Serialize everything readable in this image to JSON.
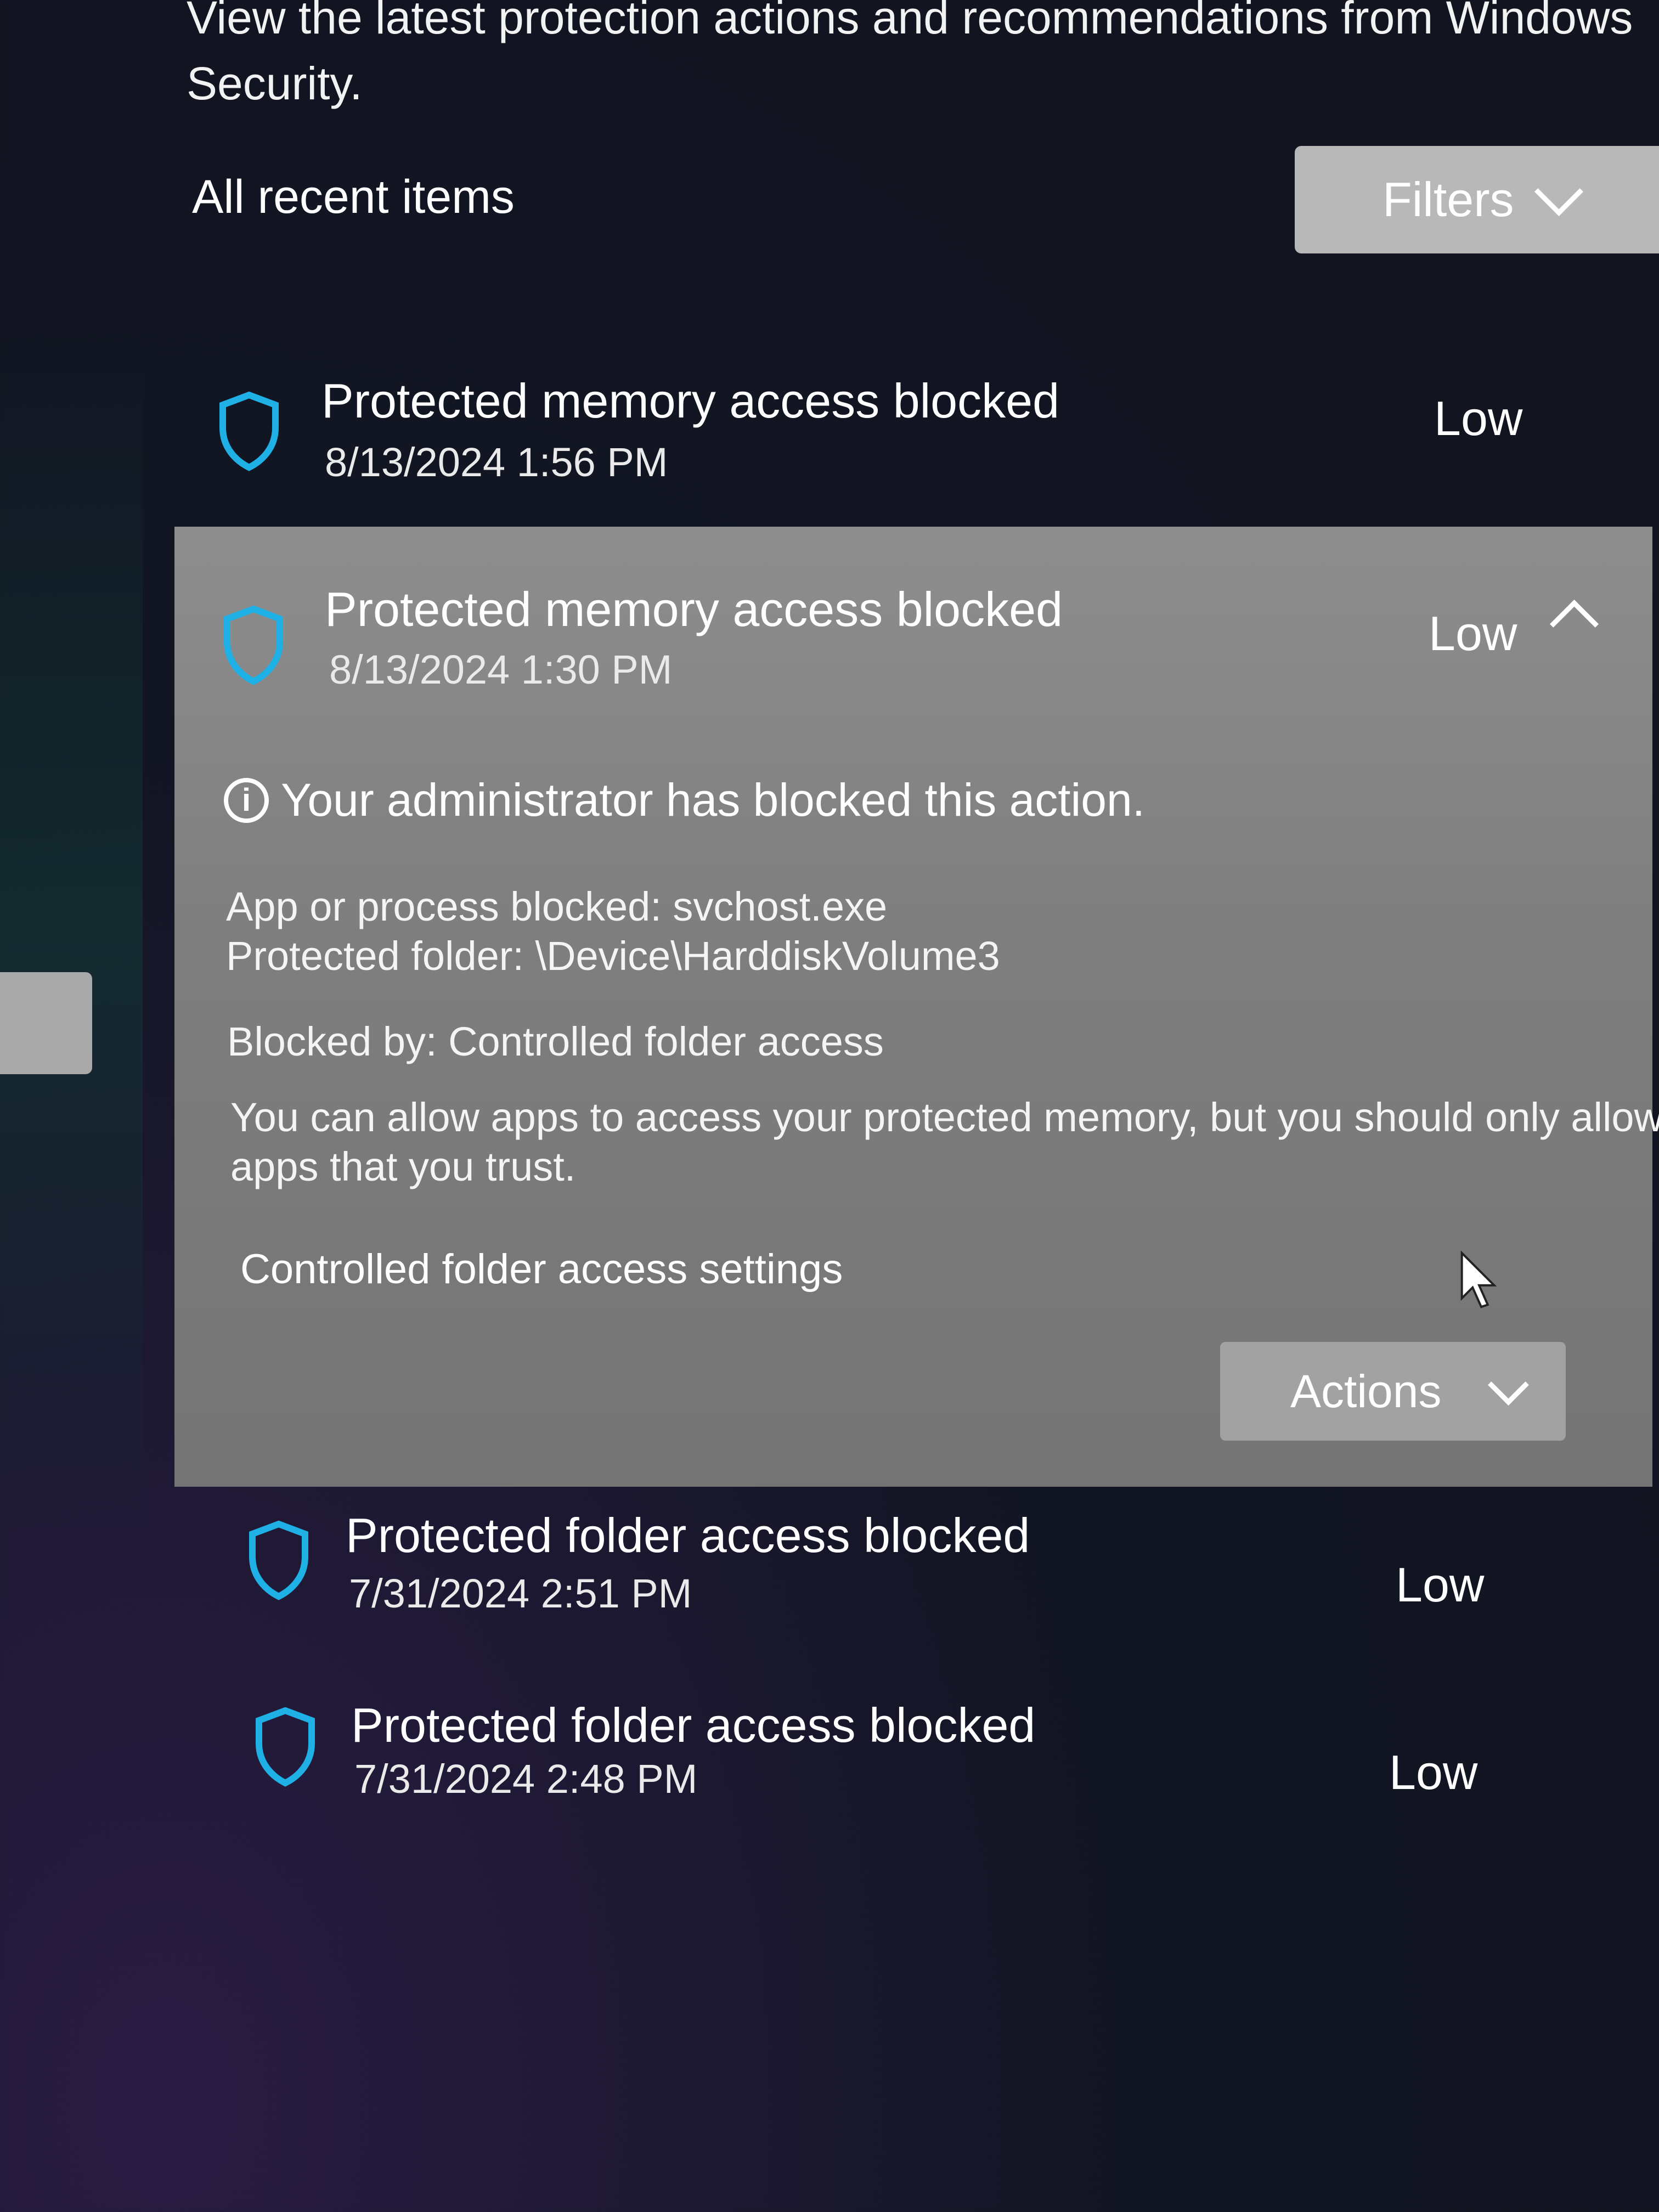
{
  "header": {
    "description_line1": "View the latest protection actions and recommendations from Windows",
    "description_line2": "Security.",
    "section_title": "All recent items",
    "filters_label": "Filters"
  },
  "items": [
    {
      "title": "Protected memory access blocked",
      "date": "8/13/2024 1:56 PM",
      "level": "Low"
    },
    {
      "title": "Protected memory access blocked",
      "date": "8/13/2024 1:30 PM",
      "level": "Low"
    },
    {
      "title": "Protected folder access blocked",
      "date": "7/31/2024 2:51 PM",
      "level": "Low"
    },
    {
      "title": "Protected folder access blocked",
      "date": "7/31/2024 2:48 PM",
      "level": "Low"
    }
  ],
  "expanded": {
    "info_icon_glyph": "i",
    "notice": "Your administrator has blocked this action.",
    "app_blocked": "App or process blocked: svchost.exe",
    "protected_folder": "Protected folder:  \\Device\\HarddiskVolume3",
    "blocked_by": "Blocked by:  Controlled folder access",
    "explanation_line1": "You can allow apps to access your protected memory, but you should only allow",
    "explanation_line2": "apps that you trust.",
    "settings_link": "Controlled folder access settings",
    "actions_label": "Actions"
  },
  "icons": {
    "shield": "shield-icon",
    "info": "info-icon",
    "chevron_down": "chevron-down-icon",
    "chevron_up": "chevron-up-icon",
    "cursor": "mouse-cursor"
  },
  "colors": {
    "accent": "#1fb0e6",
    "background": "#12151f",
    "expanded_panel": "#858585",
    "button": "#b8b8b8"
  }
}
